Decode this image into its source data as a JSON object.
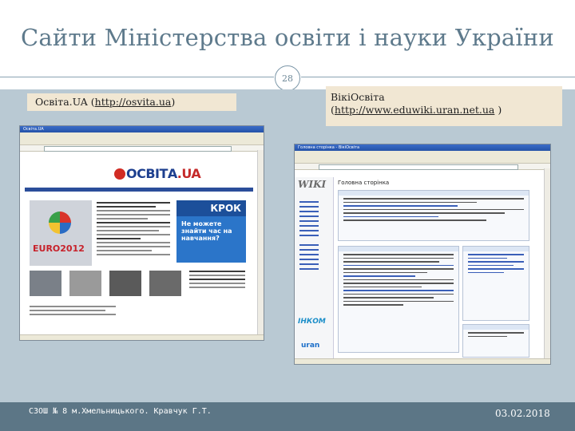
{
  "slide": {
    "title": "Сайти Міністерства освіти і науки України",
    "page_number": "28",
    "footer_left": "СЗОШ № 8 м.Хмельницького. Кравчук Г.Т.",
    "footer_date": "03.02.2018"
  },
  "left_panel": {
    "caption_prefix": "Освіта.UA (",
    "caption_link": "http://osvita.ua",
    "caption_suffix": ")",
    "window_title": "Освіта.UA",
    "logo_main": "ОСВІТА",
    "logo_suffix": ".UA",
    "euro_text": "EURO2012",
    "krok_title": "КРОК",
    "krok_question": "Не можете знайти час на навчання?"
  },
  "right_panel": {
    "caption_line1": "ВікіОсвіта",
    "caption_link": "http://www.eduwiki.uran.net.ua",
    "caption_suffix": " )",
    "window_title": "Головна сторінка - ВікіОсвіта",
    "wiki_logo": "WIKI",
    "page_heading": "Головна сторінка",
    "inkom_logo": "ІНКОМ",
    "uran_logo": "uran"
  },
  "colors": {
    "title_color": "#5e7a8c",
    "content_bg": "#b9c9d3",
    "footer_band": "#5c7686",
    "caption_bg": "#f1e7d3"
  }
}
